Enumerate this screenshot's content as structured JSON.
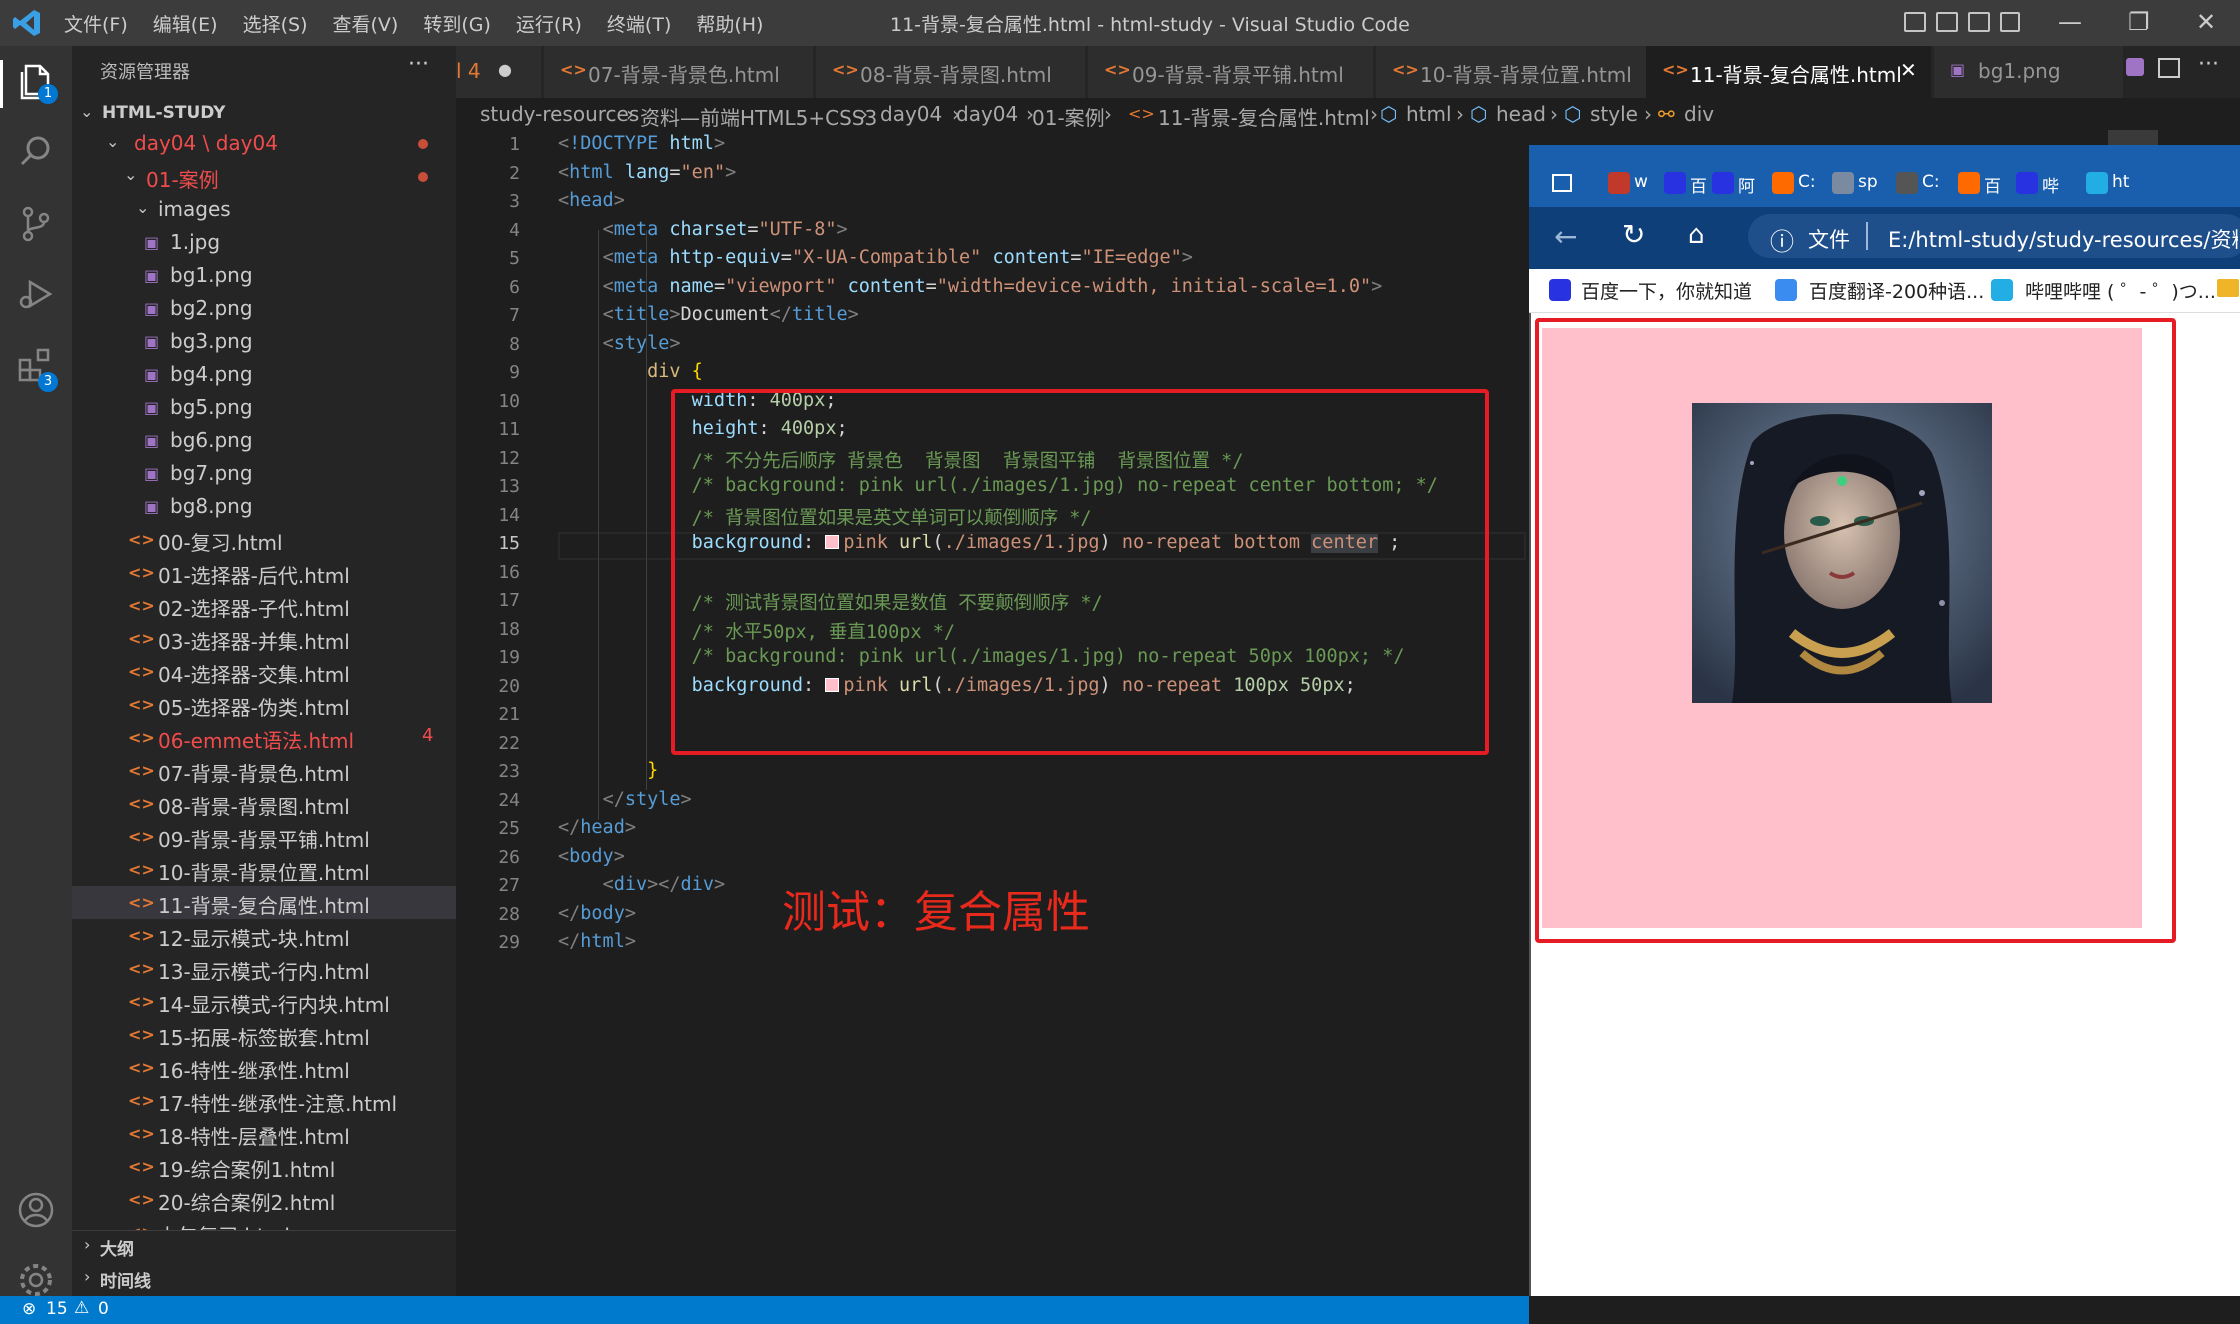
{
  "titlebar": {
    "menus": [
      "文件(F)",
      "编辑(E)",
      "选择(S)",
      "查看(V)",
      "转到(G)",
      "运行(R)",
      "终端(T)",
      "帮助(H)"
    ],
    "title": "11-背景-复合属性.html - html-study - Visual Studio Code"
  },
  "activity": {
    "explorer_badge": "1",
    "extensions_badge": "3"
  },
  "sidebar": {
    "title": "资源管理器",
    "more": "···",
    "root": "HTML-STUDY",
    "folder_day04": "day04 \\ day04",
    "folder_cases": "01-案例",
    "folder_images": "images",
    "images": [
      "1.jpg",
      "bg1.png",
      "bg2.png",
      "bg3.png",
      "bg4.png",
      "bg5.png",
      "bg6.png",
      "bg7.png",
      "bg8.png"
    ],
    "files": [
      "00-复习.html",
      "01-选择器-后代.html",
      "02-选择器-子代.html",
      "03-选择器-并集.html",
      "04-选择器-交集.html",
      "05-选择器-伪类.html",
      "06-emmet语法.html",
      "07-背景-背景色.html",
      "08-背景-背景图.html",
      "09-背景-背景平铺.html",
      "10-背景-背景位置.html",
      "11-背景-复合属性.html",
      "12-显示模式-块.html",
      "13-显示模式-行内.html",
      "14-显示模式-行内块.html",
      "15-拓展-标签嵌套.html",
      "16-特性-继承性.html",
      "17-特性-继承性-注意.html",
      "18-特性-层叠性.html",
      "19-综合案例1.html",
      "20-综合案例2.html",
      "上午复习.html"
    ],
    "emmet_errors": "4",
    "outline": "大纲",
    "timeline": "时间线"
  },
  "tabs": [
    {
      "label": "l 4"
    },
    {
      "label": "07-背景-背景色.html"
    },
    {
      "label": "08-背景-背景图.html"
    },
    {
      "label": "09-背景-背景平铺.html"
    },
    {
      "label": "10-背景-背景位置.html"
    },
    {
      "label": "11-背景-复合属性.html",
      "close": "✕"
    },
    {
      "label": "bg1.png"
    }
  ],
  "breadcrumb": [
    "study-resources",
    "资料—前端HTML5+CSS3",
    "day04",
    "day04",
    "01-案例",
    "11-背景-复合属性.html",
    "html",
    "head",
    "style",
    "div"
  ],
  "editor": {
    "current_line": 15,
    "lines": [
      "<!DOCTYPE html>",
      "<html lang=\"en\">",
      "<head>",
      "    <meta charset=\"UTF-8\">",
      "    <meta http-equiv=\"X-UA-Compatible\" content=\"IE=edge\">",
      "    <meta name=\"viewport\" content=\"width=device-width, initial-scale=1.0\">",
      "    <title>Document</title>",
      "    <style>",
      "        div {",
      "            width: 400px;",
      "            height: 400px;",
      "            /* 不分先后顺序 背景色  背景图  背景图平铺  背景图位置 */",
      "            /* background: pink url(./images/1.jpg) no-repeat center bottom; */",
      "            /* 背景图位置如果是英文单词可以颠倒顺序 */",
      "            background: pink url(./images/1.jpg) no-repeat bottom center ;",
      "",
      "            /* 测试背景图位置如果是数值 不要颠倒顺序 */",
      "            /* 水平50px, 垂直100px */",
      "            /* background: pink url(./images/1.jpg) no-repeat 50px 100px; */",
      "            background: pink url(./images/1.jpg) no-repeat 100px 50px;",
      "",
      "",
      "        }",
      "    </style>",
      "</head>",
      "<body>",
      "    <div></div>",
      "</body>",
      "</html>"
    ]
  },
  "annotation": "测试：复合属性",
  "browser": {
    "tab_labels": [
      "w",
      "百",
      "阿",
      "C:",
      "sp",
      "C:",
      "百",
      "哔",
      "ht"
    ],
    "file_label": "文件",
    "address": "E:/html-study/study-resources/资料—",
    "bookmarks": [
      "百度一下，你就知道",
      "百度翻译-200种语...",
      "哔哩哔哩 ( ゜- ゜)つ..."
    ]
  },
  "statusbar": {
    "errors": "15",
    "warnings": "0"
  },
  "colors": {
    "accent": "#007acc",
    "highlight_box": "#e51c23",
    "div_background": "#ffc0cb"
  }
}
